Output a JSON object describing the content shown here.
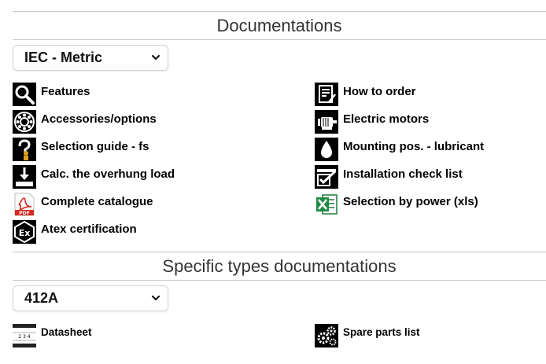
{
  "documentations": {
    "title": "Documentations",
    "selected": "IEC - Metric",
    "left_items": [
      {
        "label": "Features",
        "icon": "magnifier-icon"
      },
      {
        "label": "Accessories/options",
        "icon": "bearing-icon"
      },
      {
        "label": "Selection guide - fs",
        "icon": "question-person-icon"
      },
      {
        "label": "Calc. the overhung load",
        "icon": "load-arrow-icon"
      },
      {
        "label": "Complete catalogue",
        "icon": "pdf-icon"
      },
      {
        "label": "Atex certification",
        "icon": "atex-icon"
      }
    ],
    "right_items": [
      {
        "label": "How to order",
        "icon": "order-form-icon"
      },
      {
        "label": "Electric motors",
        "icon": "motor-icon"
      },
      {
        "label": "Mounting pos. - lubricant",
        "icon": "oil-drop-icon"
      },
      {
        "label": "Installation check list",
        "icon": "checklist-icon"
      },
      {
        "label": "Selection by power (xls)",
        "icon": "excel-icon"
      }
    ]
  },
  "specific": {
    "title": "Specific types documentations",
    "selected": "412A",
    "items": [
      {
        "label": "Datasheet",
        "icon": "datasheet-icon"
      },
      {
        "label": "Spare parts list",
        "icon": "gears-icon"
      }
    ]
  }
}
